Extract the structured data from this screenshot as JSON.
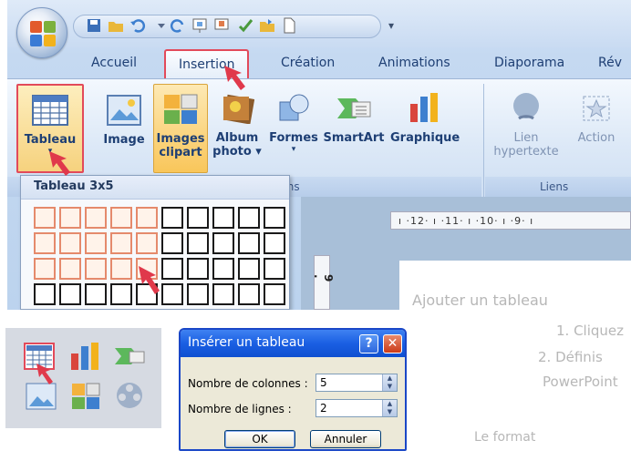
{
  "ribbon": {
    "tabs": [
      "Accueil",
      "Insertion",
      "Création",
      "Animations",
      "Diaporama",
      "Rév"
    ],
    "active_tab": "Insertion",
    "buttons": {
      "tableau": "Tableau",
      "image": "Image",
      "images_clipart_1": "Images",
      "images_clipart_2": "clipart",
      "album_photo_1": "Album",
      "album_photo_2": "photo",
      "formes": "Formes",
      "smartart": "SmartArt",
      "graphique": "Graphique",
      "lien_hypertexte_1": "Lien",
      "lien_hypertexte_2": "hypertexte",
      "action": "Action"
    },
    "groups": {
      "illustrations_partial": "ations",
      "liens": "Liens"
    }
  },
  "table_dropdown": {
    "title": "Tableau 3x5",
    "columns": 10,
    "rows": 4,
    "selected_columns": 5,
    "selected_rows": 3
  },
  "ruler": {
    "horizontal": "ı ·12· ı ·11· ı ·10· ı ·9· ı",
    "vertical": "9 ·"
  },
  "background_text": {
    "line1": "Ajouter un tableau",
    "line2": "1. Cliquez",
    "line3": "2. Définis",
    "line4": "PowerPoint",
    "line5": "Le format"
  },
  "dialog": {
    "title": "Insérer un tableau",
    "help_label": "?",
    "close_label": "✕",
    "columns_label": "Nombre de colonnes :",
    "columns_value": "5",
    "rows_label": "Nombre de lignes :",
    "rows_value": "2",
    "ok_label": "OK",
    "cancel_label": "Annuler"
  },
  "colors": {
    "highlight_red": "#e24a5a",
    "selection_orange": "#f9c65a",
    "dialog_blue": "#1a5fe3"
  }
}
